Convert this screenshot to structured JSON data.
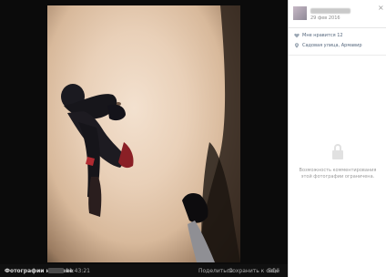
{
  "post": {
    "date": "29 фев 2016",
    "likes_text": "Мне нравится  12",
    "location": "Садовая улица, Армавир",
    "comments_disabled": "Возможность комментирования этой фотографии ограничена."
  },
  "footer": {
    "album_label": "Фотографии на стене",
    "time": "11:43:21",
    "actions": [
      "Поделиться",
      "Сохранить к себе",
      "Ещё"
    ]
  },
  "window": {
    "close": "×"
  },
  "colors": {
    "link": "#55677d",
    "accent": "#2a5885"
  },
  "icons": [
    "heart-icon",
    "location-pin-icon",
    "lock-icon",
    "close-icon"
  ]
}
